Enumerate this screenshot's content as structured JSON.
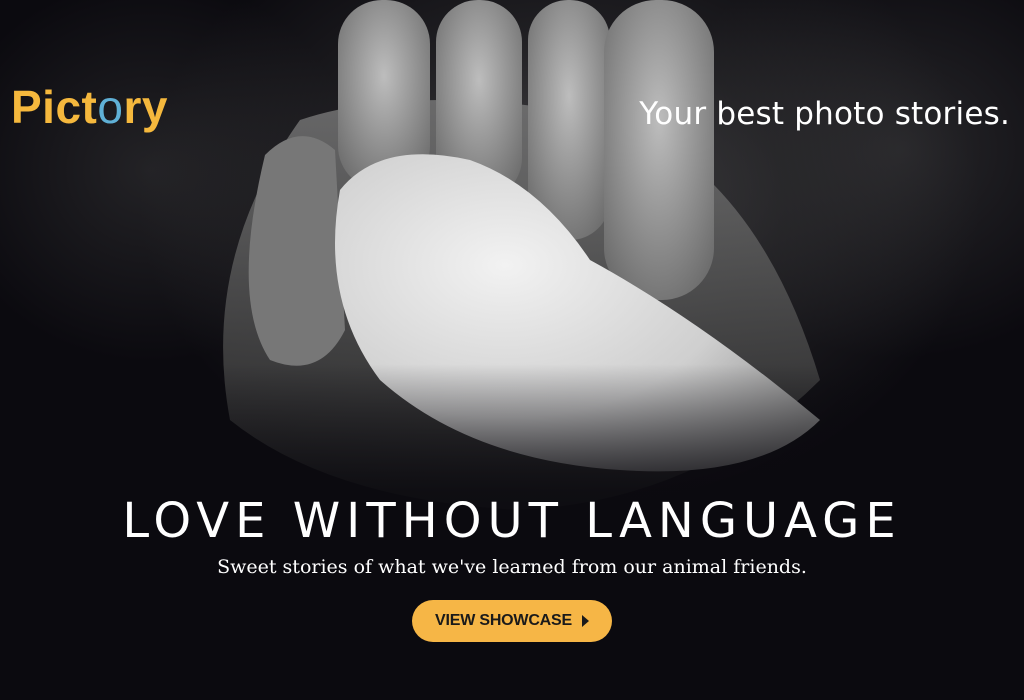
{
  "brand": {
    "logo_part1": "Pict",
    "logo_o": "o",
    "logo_part2": "ry",
    "primary_color": "#f5b83d",
    "accent_color": "#5fb0d6"
  },
  "header": {
    "tagline": "Your best photo stories."
  },
  "hero": {
    "headline": "LOVE WITHOUT LANGUAGE",
    "subhead": "Sweet stories of what we've learned from our animal friends.",
    "image_subject": "hand-and-cat-paw-photo"
  },
  "cta": {
    "label": "VIEW SHOWCASE",
    "icon": "triangle-right-icon",
    "color": "#f6b646"
  }
}
